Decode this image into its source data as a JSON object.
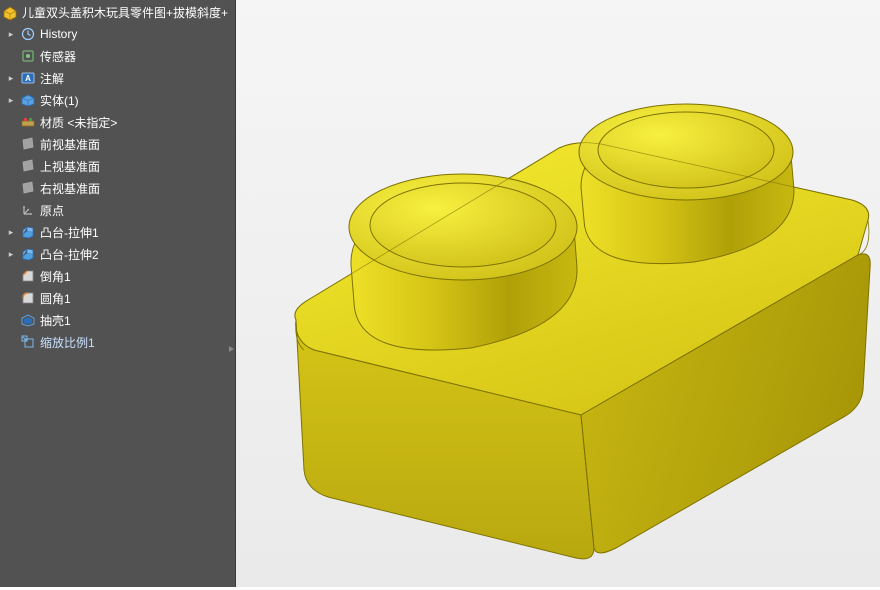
{
  "part": {
    "title": "儿童双头盖积木玩具零件图+拔模斜度+"
  },
  "tree": {
    "items": [
      {
        "kind": "expand",
        "label": "History"
      },
      {
        "kind": "sensor",
        "label": "传感器"
      },
      {
        "kind": "annotation",
        "label": "注解"
      },
      {
        "kind": "solid",
        "label": "实体(1)"
      },
      {
        "kind": "material",
        "label": "材质 <未指定>"
      },
      {
        "kind": "plane",
        "label": "前视基准面"
      },
      {
        "kind": "plane",
        "label": "上视基准面"
      },
      {
        "kind": "plane",
        "label": "右视基准面"
      },
      {
        "kind": "origin",
        "label": "原点"
      },
      {
        "kind": "extrude",
        "label": "凸台-拉伸1"
      },
      {
        "kind": "extrude",
        "label": "凸台-拉伸2"
      },
      {
        "kind": "chamfer",
        "label": "倒角1"
      },
      {
        "kind": "fillet",
        "label": "圆角1"
      },
      {
        "kind": "shell",
        "label": "抽壳1"
      },
      {
        "kind": "scale",
        "label": "缩放比例1"
      }
    ]
  }
}
